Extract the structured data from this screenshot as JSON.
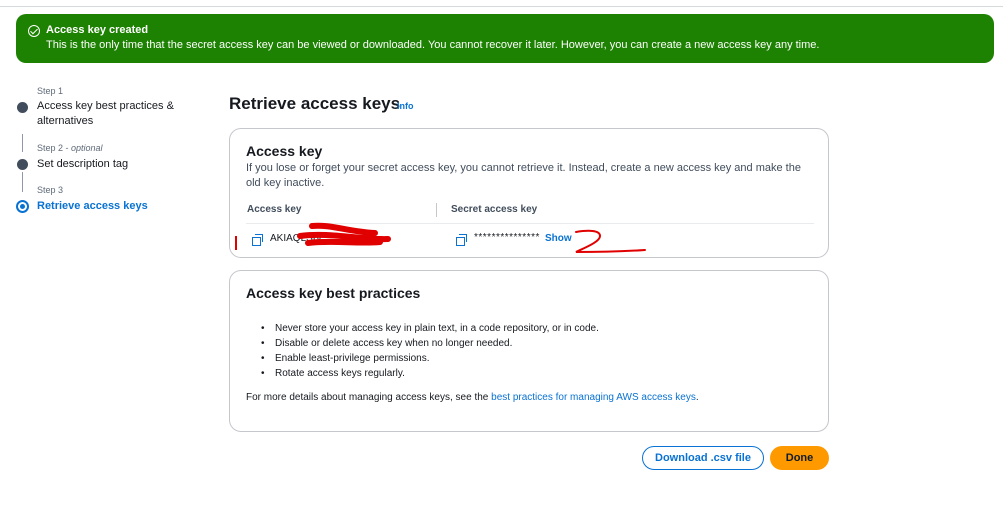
{
  "flash": {
    "title": "Access key created",
    "message": "This is the only time that the secret access key can be viewed or downloaded. You cannot recover it later. However, you can create a new access key any time.",
    "color": "#1d8102"
  },
  "steps": [
    {
      "small": "Step 1",
      "label": "Access key best practices & alternatives"
    },
    {
      "small": "Step 2",
      "optional": "optional",
      "label": "Set description tag"
    },
    {
      "small": "Step 3",
      "label": "Retrieve access keys"
    }
  ],
  "page": {
    "title": "Retrieve access keys",
    "info": "Info"
  },
  "access_key_card": {
    "title": "Access key",
    "description": "If you lose or forget your secret access key, you cannot retrieve it. Instead, create a new access key and make the old key inactive.",
    "col_access_key": "Access key",
    "col_secret_key": "Secret access key",
    "access_key_value": "AKIAQLSIV",
    "secret_key_masked": "***************",
    "show_label": "Show"
  },
  "best_practices": {
    "title": "Access key best practices",
    "items": [
      "Never store your access key in plain text, in a code repository, or in code.",
      "Disable or delete access key when no longer needed.",
      "Enable least-privilege permissions.",
      "Rotate access keys regularly."
    ],
    "more_prefix": "For more details about managing access keys, see the ",
    "more_link": "best practices for managing AWS access keys",
    "more_suffix": "."
  },
  "actions": {
    "download": "Download .csv file",
    "done": "Done"
  },
  "annotations": {
    "mark1": "1",
    "mark2": "2",
    "color": "#e00000"
  }
}
